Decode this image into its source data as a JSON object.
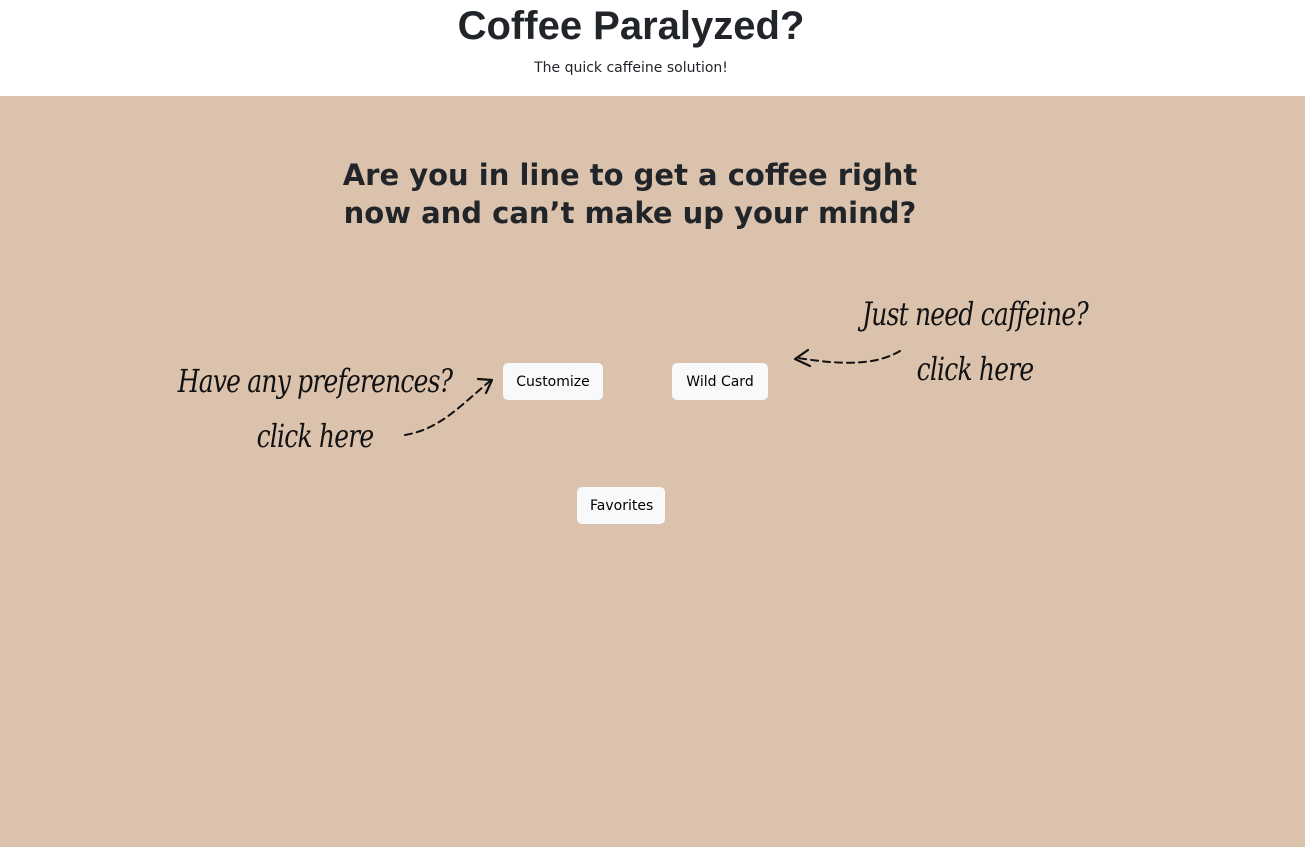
{
  "header": {
    "title": "Coffee Paralyzed?",
    "subtitle": "The quick caffeine solution!"
  },
  "main": {
    "question": "Are you in line to get a coffee right now and can’t make up your mind?",
    "buttons": {
      "customize": "Customize",
      "wildcard": "Wild Card",
      "favorites": "Favorites"
    },
    "annotations": {
      "left_line1": "Have any preferences?",
      "left_line2": "click here",
      "right_line1": "Just need caffeine?",
      "right_line2": "click here"
    }
  },
  "colors": {
    "background": "#dbc2ac",
    "header_background": "#ffffff",
    "button_background": "#f8f9fa",
    "text": "#212529"
  },
  "icons": [
    "dashed-arrow-icon"
  ]
}
